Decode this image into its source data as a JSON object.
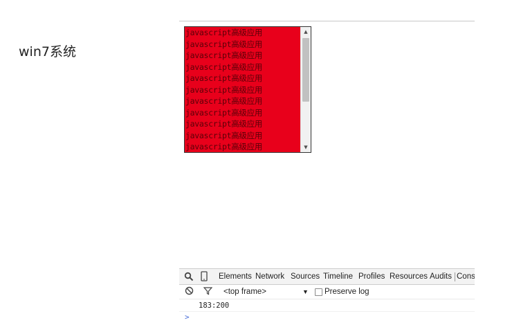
{
  "caption": "win7系统",
  "textarea": {
    "lines": [
      "javascript高级应用",
      "javascript高级应用",
      "javascript高级应用",
      "javascript高级应用",
      "javascript高级应用",
      "javascript高级应用",
      "javascript高级应用",
      "javascript高级应用",
      "javascript高级应用",
      "javascript高级应用",
      "javascript高级应用"
    ],
    "background_color": "#e8001b",
    "text_color": "#5a0008"
  },
  "devtools": {
    "toolbar_icons": [
      "search-icon",
      "device-mode-icon"
    ],
    "tabs": [
      "Elements",
      "Network",
      "Sources",
      "Timeline",
      "Profiles",
      "Resources",
      "Audits",
      "Cons"
    ],
    "filter": {
      "clear_icon": "clear-console-icon",
      "filter_icon": "filter-icon",
      "frame_select": "<top frame>",
      "frame_dropdown_icon": "dropdown-arrow-icon",
      "preserve_log_label": "Preserve log",
      "preserve_log_checked": false
    },
    "console_output": "183:200",
    "prompt": ">"
  }
}
